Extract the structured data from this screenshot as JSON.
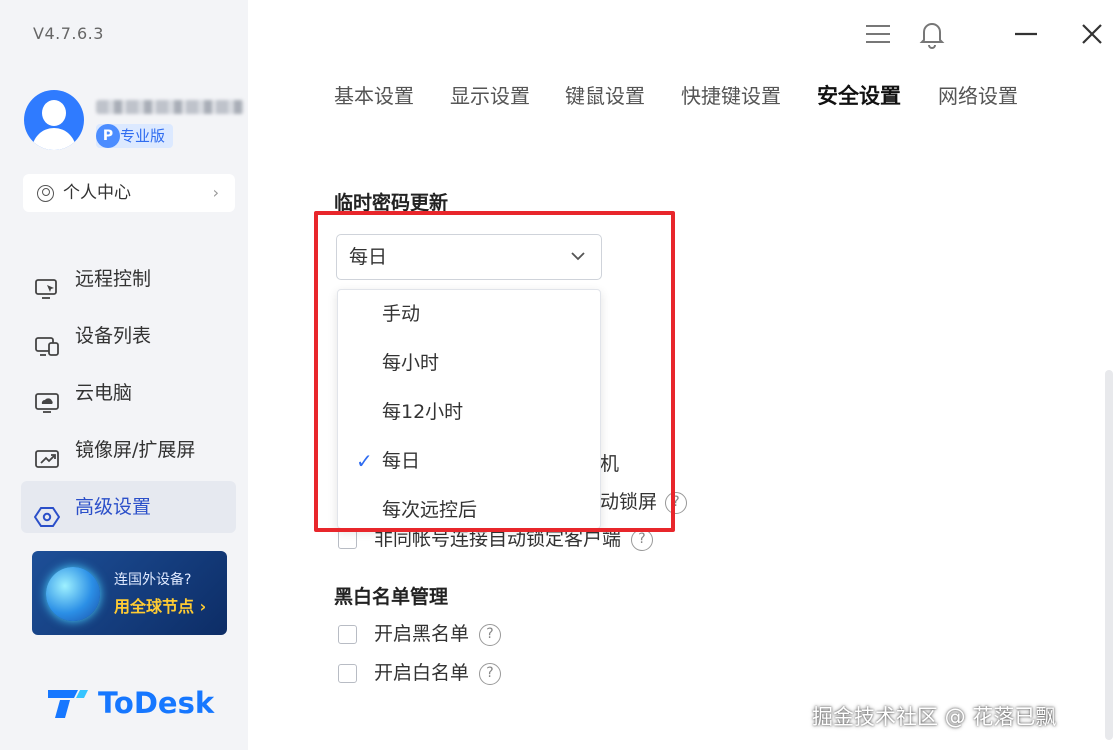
{
  "app": {
    "version": "V4.7.6.3",
    "logo_text": "ToDesk"
  },
  "sidebar": {
    "badge": "专业版",
    "badge_icon_letter": "P",
    "personal_center": "个人中心",
    "items": [
      {
        "label": "远程控制",
        "icon": "monitor-remote-icon"
      },
      {
        "label": "设备列表",
        "icon": "devices-icon"
      },
      {
        "label": "云电脑",
        "icon": "cloud-pc-icon"
      },
      {
        "label": "镜像屏/扩展屏",
        "icon": "mirror-screen-icon"
      },
      {
        "label": "高级设置",
        "icon": "settings-hex-icon",
        "active": true
      }
    ],
    "promo": {
      "line1": "连国外设备?",
      "line2": "用全球节点 ›"
    }
  },
  "header": {
    "icons": [
      "menu-icon",
      "bell-icon",
      "minimize-icon",
      "close-icon"
    ]
  },
  "tabs": [
    {
      "label": "基本设置"
    },
    {
      "label": "显示设置"
    },
    {
      "label": "键鼠设置"
    },
    {
      "label": "快捷键设置"
    },
    {
      "label": "安全设置",
      "active": true
    },
    {
      "label": "网络设置"
    }
  ],
  "temp_password": {
    "title": "临时密码更新",
    "selected": "每日",
    "options": [
      {
        "label": "手动"
      },
      {
        "label": "每小时"
      },
      {
        "label": "每12小时"
      },
      {
        "label": "每日",
        "checked": true
      },
      {
        "label": "每次远控后"
      }
    ]
  },
  "partially_hidden": {
    "row1_tail": "机",
    "row2_tail": "动锁屏",
    "row3_label": "非同帐号连接自动锁定客户端"
  },
  "blacklist": {
    "title": "黑白名单管理",
    "options": [
      {
        "label": "开启黑名单"
      },
      {
        "label": "开启白名单"
      }
    ]
  },
  "watermark": "掘金技术社区 @ 花落已飘",
  "colors": {
    "accent": "#2f6cf0",
    "highlight_border": "#e8262b",
    "sidebar_bg": "#f3f4f7"
  }
}
